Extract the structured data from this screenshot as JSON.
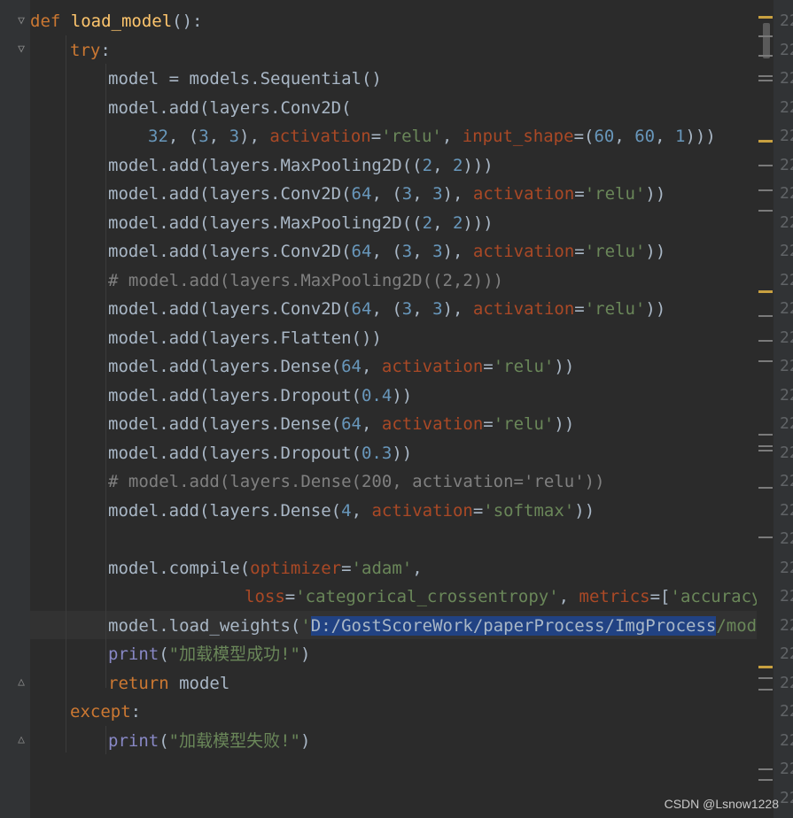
{
  "editor": {
    "lines": [
      {
        "parts": [
          [
            "kw",
            "def "
          ],
          [
            "fn",
            "load_model"
          ],
          [
            "",
            "():"
          ]
        ]
      },
      {
        "parts": [
          [
            "kw",
            "try"
          ],
          [
            "",
            ":"
          ]
        ]
      },
      {
        "parts": [
          [
            "",
            "model = models.Sequential()"
          ]
        ]
      },
      {
        "parts": [
          [
            "",
            "model.add(layers.Conv2D("
          ]
        ]
      },
      {
        "parts": [
          [
            "num",
            "32"
          ],
          [
            "",
            ", ("
          ],
          [
            "num",
            "3"
          ],
          [
            "",
            ", "
          ],
          [
            "num",
            "3"
          ],
          [
            "",
            "), "
          ],
          [
            "param",
            "activation"
          ],
          [
            "",
            "="
          ],
          [
            "str",
            "'relu'"
          ],
          [
            "",
            ", "
          ],
          [
            "param",
            "input_shape"
          ],
          [
            "",
            "=("
          ],
          [
            "num",
            "60"
          ],
          [
            "",
            ", "
          ],
          [
            "num",
            "60"
          ],
          [
            "",
            ", "
          ],
          [
            "num",
            "1"
          ],
          [
            "",
            ")))"
          ]
        ]
      },
      {
        "parts": [
          [
            "",
            "model.add(layers.MaxPooling2D(("
          ],
          [
            "num",
            "2"
          ],
          [
            "",
            ", "
          ],
          [
            "num",
            "2"
          ],
          [
            "",
            "))) "
          ]
        ]
      },
      {
        "parts": [
          [
            "",
            "model.add(layers.Conv2D("
          ],
          [
            "num",
            "64"
          ],
          [
            "",
            ", ("
          ],
          [
            "num",
            "3"
          ],
          [
            "",
            ", "
          ],
          [
            "num",
            "3"
          ],
          [
            "",
            "), "
          ],
          [
            "param",
            "activation"
          ],
          [
            "",
            "="
          ],
          [
            "str",
            "'relu'"
          ],
          [
            "",
            "))"
          ]
        ]
      },
      {
        "parts": [
          [
            "",
            "model.add(layers.MaxPooling2D(("
          ],
          [
            "num",
            "2"
          ],
          [
            "",
            ", "
          ],
          [
            "num",
            "2"
          ],
          [
            "",
            ")))"
          ]
        ]
      },
      {
        "parts": [
          [
            "",
            "model.add(layers.Conv2D("
          ],
          [
            "num",
            "64"
          ],
          [
            "",
            ", ("
          ],
          [
            "num",
            "3"
          ],
          [
            "",
            ", "
          ],
          [
            "num",
            "3"
          ],
          [
            "",
            "), "
          ],
          [
            "param",
            "activation"
          ],
          [
            "",
            "="
          ],
          [
            "str",
            "'relu'"
          ],
          [
            "",
            "))"
          ]
        ]
      },
      {
        "parts": [
          [
            "cmt",
            "# model.add(layers.MaxPooling2D((2,2)))"
          ]
        ]
      },
      {
        "parts": [
          [
            "",
            "model.add(layers.Conv2D("
          ],
          [
            "num",
            "64"
          ],
          [
            "",
            ", ("
          ],
          [
            "num",
            "3"
          ],
          [
            "",
            ", "
          ],
          [
            "num",
            "3"
          ],
          [
            "",
            "), "
          ],
          [
            "param",
            "activation"
          ],
          [
            "",
            "="
          ],
          [
            "str",
            "'relu'"
          ],
          [
            "",
            "))"
          ]
        ]
      },
      {
        "parts": [
          [
            "",
            "model.add(layers.Flatten())"
          ]
        ]
      },
      {
        "parts": [
          [
            "",
            "model.add(layers.Dense("
          ],
          [
            "num",
            "64"
          ],
          [
            "",
            ", "
          ],
          [
            "param",
            "activation"
          ],
          [
            "",
            "="
          ],
          [
            "str",
            "'relu'"
          ],
          [
            "",
            "))"
          ]
        ]
      },
      {
        "parts": [
          [
            "",
            "model.add(layers.Dropout("
          ],
          [
            "num",
            "0.4"
          ],
          [
            "",
            "))"
          ]
        ]
      },
      {
        "parts": [
          [
            "",
            "model.add(layers.Dense("
          ],
          [
            "num",
            "64"
          ],
          [
            "",
            ", "
          ],
          [
            "param",
            "activation"
          ],
          [
            "",
            "="
          ],
          [
            "str",
            "'relu'"
          ],
          [
            "",
            "))"
          ]
        ]
      },
      {
        "parts": [
          [
            "",
            "model.add(layers.Dropout("
          ],
          [
            "num",
            "0.3"
          ],
          [
            "",
            "))"
          ]
        ]
      },
      {
        "parts": [
          [
            "cmt",
            "# model.add(layers.Dense(200, activation='relu'))"
          ]
        ]
      },
      {
        "parts": [
          [
            "",
            "model.add(layers.Dense("
          ],
          [
            "num",
            "4"
          ],
          [
            "",
            ", "
          ],
          [
            "param",
            "activation"
          ],
          [
            "",
            "="
          ],
          [
            "str",
            "'softmax'"
          ],
          [
            "",
            "))"
          ]
        ]
      },
      {
        "parts": []
      },
      {
        "parts": [
          [
            "",
            "model.compile("
          ],
          [
            "param",
            "optimizer"
          ],
          [
            "",
            "="
          ],
          [
            "str",
            "'adam'"
          ],
          [
            "",
            ","
          ]
        ]
      },
      {
        "parts": [
          [
            "param",
            "loss"
          ],
          [
            "",
            "="
          ],
          [
            "str",
            "'categorical_crossentropy'"
          ],
          [
            "",
            ", "
          ],
          [
            "param",
            "metrics"
          ],
          [
            "",
            "=["
          ],
          [
            "str",
            "'accuracy'"
          ],
          [
            "",
            "])"
          ]
        ]
      },
      {
        "parts": [
          [
            "",
            "model.load_weights("
          ],
          [
            "str",
            "'"
          ],
          [
            "sel",
            "D:/GostScoreWork/paperProcess/ImgProcess"
          ],
          [
            "str",
            "/model/mo"
          ]
        ]
      },
      {
        "parts": [
          [
            "bi",
            "print"
          ],
          [
            "",
            "("
          ],
          [
            "str",
            "\"加载模型成功!\""
          ],
          [
            "",
            ")"
          ]
        ]
      },
      {
        "parts": [
          [
            "kw",
            "return "
          ],
          [
            "",
            "model"
          ]
        ]
      },
      {
        "parts": [
          [
            "kw",
            "except"
          ],
          [
            "",
            ":"
          ]
        ]
      },
      {
        "parts": [
          [
            "bi",
            "print"
          ],
          [
            "",
            "("
          ],
          [
            "str",
            "\"加载模型失败!\""
          ],
          [
            "",
            ")"
          ]
        ]
      }
    ],
    "line_number_prefix": "22"
  },
  "watermark": "CSDN @Lsnow1228"
}
